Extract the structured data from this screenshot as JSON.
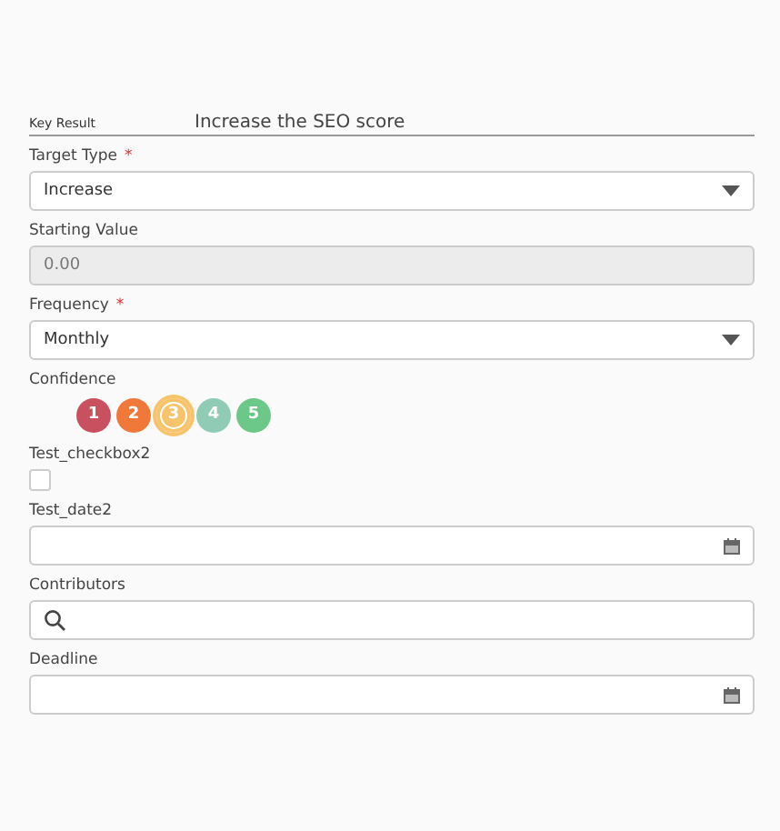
{
  "header": {
    "label": "Key Result",
    "value": "Increase the SEO score"
  },
  "fields": [
    {
      "kind": "select",
      "label": "Target Type",
      "required_mark": "*",
      "value": "Increase"
    },
    {
      "kind": "text",
      "label": "Starting Value",
      "disabled": true,
      "value": "0.00"
    },
    {
      "kind": "select",
      "label": "Frequency",
      "required_mark": "*",
      "value": "Monthly"
    },
    {
      "kind": "rating",
      "label": "Confidence",
      "options": [
        {
          "label": "1",
          "color": "#c9505f",
          "selected": false
        },
        {
          "label": "2",
          "color": "#f0793a",
          "selected": false
        },
        {
          "label": "3",
          "color": "#f7c46c",
          "selected": true
        },
        {
          "label": "4",
          "color": "#8fcbb5",
          "selected": false
        },
        {
          "label": "5",
          "color": "#6cc888",
          "selected": false
        }
      ]
    },
    {
      "kind": "checkbox",
      "label": "Test_checkbox2",
      "checked": false
    },
    {
      "kind": "date",
      "label": "Test_date2"
    },
    {
      "kind": "search",
      "label": "Contributors"
    },
    {
      "kind": "date",
      "label": "Deadline"
    }
  ]
}
